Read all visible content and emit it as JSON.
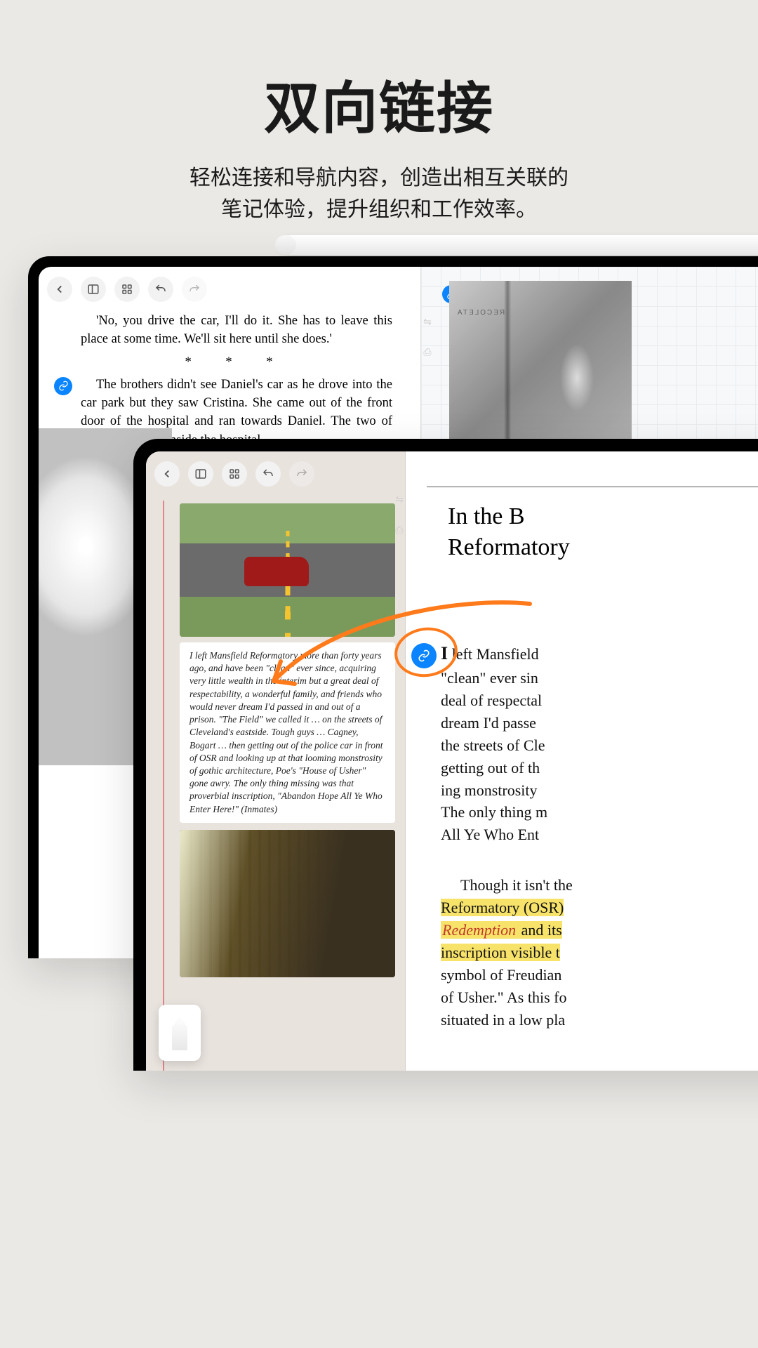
{
  "hero": {
    "title": "双向链接",
    "subtitle_l1": "轻松连接和导航内容，创造出相互关联的",
    "subtitle_l2": "笔记体验，提升组织和工作效率。"
  },
  "back_tablet": {
    "para1": "'No, you drive the car, I'll do it. She has to leave this place at some time. We'll sit here until she does.'",
    "asterisks": "* * *",
    "para2": "The brothers didn't see Daniel's car as he drove into the car park but they saw Cristina. She came out of the front door of the hospital and ran towards Daniel. The two of them went back inside the hospital.",
    "illus_sign": "RECOLETA"
  },
  "front_tablet": {
    "card1_excerpt": "I left Mansfield Reformatory more than forty years ago, and have been \"clean\" ever since, acquiring very little wealth in the interim but a great deal of respectability, a wonderful family, and friends who would never dream I'd passed in and out of a prison. \"The Field\" we called it … on the streets of Cleveland's eastside. Tough guys … Cagney, Bogart … then getting out of the police car in front of OSR and looking up at that looming monstrosity of gothic architecture, Poe's \"House of Usher\" gone awry. The only thing missing was that proverbial inscription, \"Abandon Hope All Ye Who Enter Here!\" (Inmates)",
    "chapter_line1": "In the B",
    "chapter_line2": "Reformatory",
    "lead_italic_open": "I",
    "lead_italic_rest": " left Mansfield",
    "ital_l1_rest": "\"clean\" ever sin",
    "ital_l2": "deal of respectal",
    "ital_l3": "dream I'd passe",
    "ital_l4": "the streets of Cle",
    "ital_l5": "getting out of th",
    "ital_l6": "ing monstrosity",
    "ital_l7": "The only thing m",
    "ital_l8": "All Ye Who Ent",
    "p2_l1a": "Though it isn't the",
    "p2_l2a": "Reformatory (OSR)",
    "p2_l3a": "Redemption",
    "p2_l3b": " and its ",
    "p2_l4": "inscription visible t",
    "p2_l5": "symbol of Freudian",
    "p2_l6": "of Usher.\" As this fo",
    "p2_l7": "situated in a low pla"
  },
  "icons": {
    "back": "back-icon",
    "sidebar": "sidebar-icon",
    "grid": "grid-icon",
    "undo": "undo-icon",
    "redo": "redo-icon",
    "link": "link-icon",
    "swap": "swap-icon",
    "save": "save-icon",
    "pen": "pen-icon"
  }
}
